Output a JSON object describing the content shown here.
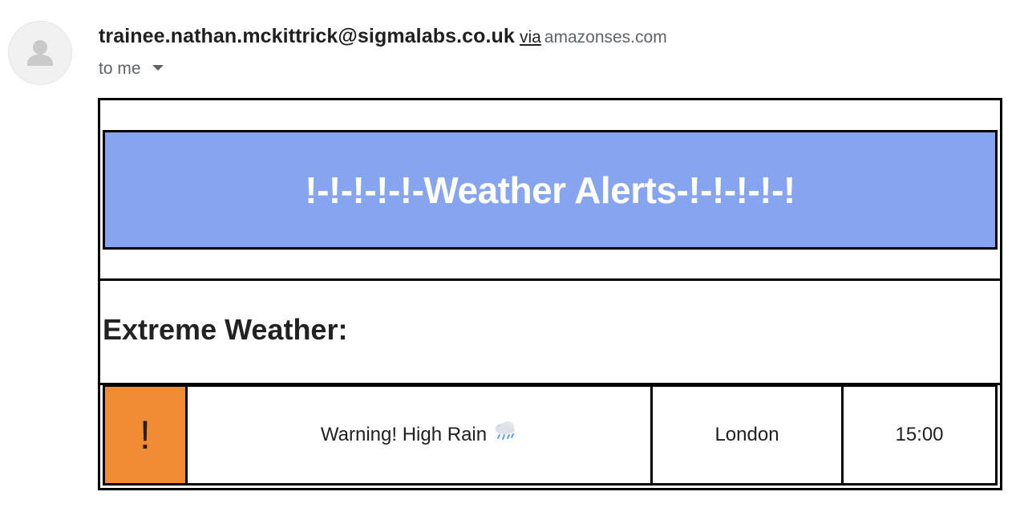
{
  "sender": {
    "email": "trainee.nathan.mckittrick@sigmalabs.co.uk",
    "via_label": "via",
    "via_domain": "amazonses.com",
    "recipient_label": "to me",
    "avatar_icon": "person-icon"
  },
  "email_body": {
    "banner_title": "!-!-!-!-!-Weather Alerts-!-!-!-!-!",
    "banner_color": "#87a4ee",
    "section_heading": "Extreme Weather:",
    "alerts": [
      {
        "icon_text": "!",
        "icon_color": "#f08b33",
        "message": "Warning! High Rain",
        "message_icon": "rain-cloud-icon",
        "location": "London",
        "time": "15:00"
      }
    ]
  }
}
